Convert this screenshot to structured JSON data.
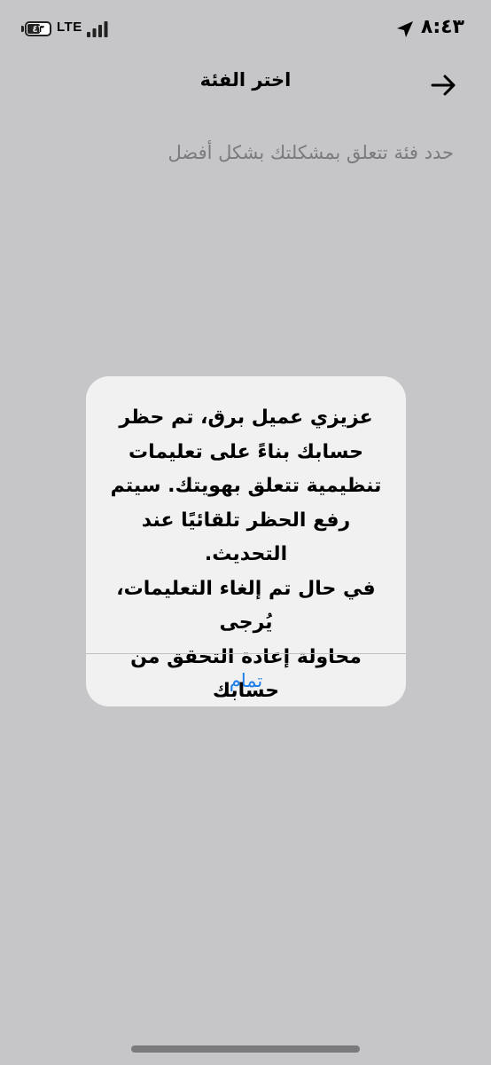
{
  "status_bar": {
    "time": "٨:٤٣",
    "network": "LTE",
    "battery_level": "٤٣",
    "location_icon": "location-arrow-icon",
    "signal_icon": "signal-bars-icon"
  },
  "nav": {
    "title": "اختر الفئة",
    "back_icon": "arrow-right-icon"
  },
  "subtitle": "حدد فئة تتعلق بمشكلتك بشكل أفضل",
  "alert": {
    "message": "عزيزي عميل برق، تم حظر\nحسابك بناءً على تعليمات\nتنظيمية تتعلق بهويتك. سيتم\nرفع الحظر تلقائيًا عند التحديث.\nفي حال تم إلغاء التعليمات، يُرجى\nمحاولة إعادة التحقق من حسابك\nلتفعيله.",
    "button_label": "تمام",
    "button_color": "#1a7dea"
  },
  "colors": {
    "background": "#c6c6c8",
    "alert_background": "#f1f1f1",
    "subtitle_text": "#7b7b7e"
  }
}
